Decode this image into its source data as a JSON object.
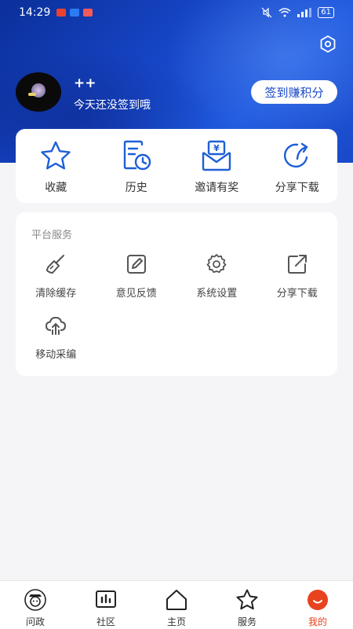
{
  "statusbar": {
    "time": "14:29",
    "battery": "61"
  },
  "header": {
    "username": "++",
    "checkin_tip": "今天还没签到哦",
    "checkin_button": "签到赚积分"
  },
  "quick_actions": [
    {
      "label": "收藏",
      "icon": "star-icon"
    },
    {
      "label": "历史",
      "icon": "history-icon"
    },
    {
      "label": "邀请有奖",
      "icon": "invite-envelope-icon"
    },
    {
      "label": "分享下载",
      "icon": "share-icon"
    }
  ],
  "services": {
    "title": "平台服务",
    "items": [
      {
        "label": "清除缓存",
        "icon": "broom-icon"
      },
      {
        "label": "意见反馈",
        "icon": "edit-icon"
      },
      {
        "label": "系统设置",
        "icon": "gear-icon"
      },
      {
        "label": "分享下载",
        "icon": "share-out-icon"
      },
      {
        "label": "移动采编",
        "icon": "cloud-upload-icon"
      }
    ]
  },
  "tabs": [
    {
      "label": "问政",
      "icon": "politics-avatar-icon"
    },
    {
      "label": "社区",
      "icon": "chart-board-icon"
    },
    {
      "label": "主页",
      "icon": "home-icon"
    },
    {
      "label": "服务",
      "icon": "star-icon"
    },
    {
      "label": "我的",
      "icon": "me-face-icon",
      "active": true
    }
  ],
  "colors": {
    "primary": "#1a49c8",
    "active_tab": "#e8431f",
    "icon_blue": "#1e5fd6"
  }
}
